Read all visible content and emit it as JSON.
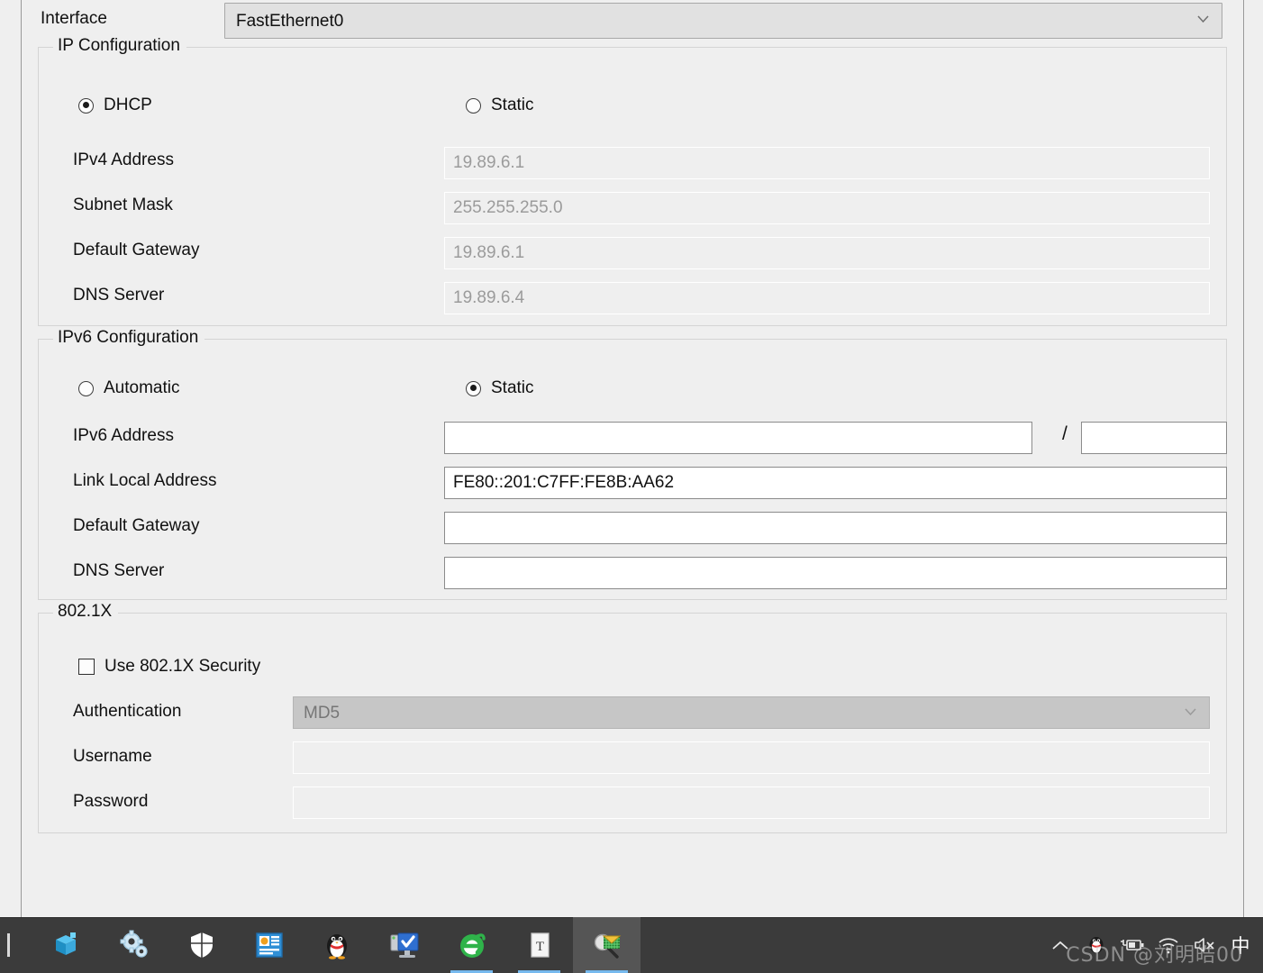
{
  "window": {
    "interface_label": "Interface",
    "interface_value": "FastEthernet0"
  },
  "ip_config": {
    "title": "IP Configuration",
    "mode_dhcp": "DHCP",
    "mode_static": "Static",
    "selected_mode": "DHCP",
    "fields": [
      {
        "label": "IPv4 Address",
        "value": "19.89.6.1"
      },
      {
        "label": "Subnet Mask",
        "value": "255.255.255.0"
      },
      {
        "label": "Default Gateway",
        "value": "19.89.6.1"
      },
      {
        "label": "DNS Server",
        "value": "19.89.6.4"
      }
    ]
  },
  "ipv6_config": {
    "title": "IPv6 Configuration",
    "mode_automatic": "Automatic",
    "mode_static": "Static",
    "selected_mode": "Static",
    "address_label": "IPv6 Address",
    "address_value": "",
    "prefix_separator": "/",
    "prefix_value": "",
    "link_local_label": "Link Local Address",
    "link_local_value": "FE80::201:C7FF:FE8B:AA62",
    "gateway_label": "Default Gateway",
    "gateway_value": "",
    "dns_label": "DNS Server",
    "dns_value": ""
  },
  "security_8021x": {
    "title": "802.1X",
    "use_checkbox_label": "Use 802.1X Security",
    "use_checked": false,
    "auth_label": "Authentication",
    "auth_value": "MD5",
    "username_label": "Username",
    "username_value": "",
    "password_label": "Password",
    "password_value": ""
  },
  "taskbar": {
    "items": [
      {
        "name": "3d-cube-icon",
        "running": false,
        "active": false
      },
      {
        "name": "gears-settings-icon",
        "running": false,
        "active": false
      },
      {
        "name": "shield-defender-icon",
        "running": false,
        "active": false
      },
      {
        "name": "blue-panel-icon",
        "running": false,
        "active": false
      },
      {
        "name": "qq-penguin-icon",
        "running": false,
        "active": false
      },
      {
        "name": "monitor-check-icon",
        "running": false,
        "active": false
      },
      {
        "name": "green-e-browser-icon",
        "running": true,
        "active": false
      },
      {
        "name": "text-document-icon",
        "running": true,
        "active": false
      },
      {
        "name": "packet-tracer-icon",
        "running": true,
        "active": true
      }
    ],
    "tray": {
      "chevron_up": "show-hidden-icons",
      "qq": "qq-tray-icon",
      "power": "power-plug-icon",
      "network": "wifi-icon",
      "volume": "volume-muted-icon",
      "ime": "中"
    },
    "watermark": "CSDN @刘明皓00"
  },
  "colors": {
    "background": "#efefef",
    "combo_bg": "#e1e1e1",
    "disabled_text": "#9b9b9b",
    "taskbar_bg": "#3b3b3b",
    "taskbar_active": "#555555",
    "running_underline": "#76b9ee"
  }
}
